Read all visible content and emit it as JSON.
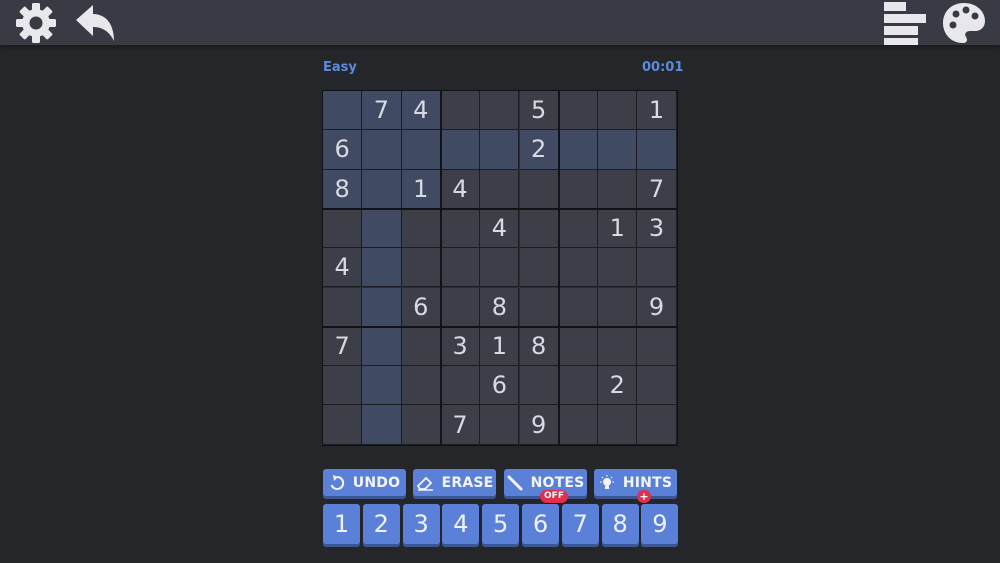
{
  "header": {
    "settings_icon": "gear-icon",
    "back_icon": "back-arrow-icon",
    "menu_icon": "bars-icon",
    "theme_icon": "palette-icon"
  },
  "status": {
    "difficulty": "Easy",
    "timer": "00:01"
  },
  "board": {
    "grid": [
      [
        "",
        "7",
        "4",
        "",
        "",
        "5",
        "",
        "",
        "1"
      ],
      [
        "6",
        "",
        "",
        "",
        "",
        "2",
        "",
        "",
        ""
      ],
      [
        "8",
        "",
        "1",
        "4",
        "",
        "",
        "",
        "",
        "7"
      ],
      [
        "",
        "",
        "",
        "",
        "4",
        "",
        "",
        "1",
        "3"
      ],
      [
        "4",
        "",
        "",
        "",
        "",
        "",
        "",
        "",
        ""
      ],
      [
        "",
        "",
        "6",
        "",
        "8",
        "",
        "",
        "",
        "9"
      ],
      [
        "7",
        "",
        "",
        "3",
        "1",
        "8",
        "",
        "",
        ""
      ],
      [
        "",
        "",
        "",
        "",
        "6",
        "",
        "",
        "2",
        ""
      ],
      [
        "",
        "",
        "",
        "7",
        "",
        "9",
        "",
        "",
        ""
      ]
    ],
    "selected_cell": {
      "row": 1,
      "col": 1
    }
  },
  "actions": {
    "undo": "UNDO",
    "erase": "ERASE",
    "notes": "NOTES",
    "notes_state": "OFF",
    "hints": "HINTS",
    "hints_badge": "+"
  },
  "numpad": [
    "1",
    "2",
    "3",
    "4",
    "5",
    "6",
    "7",
    "8",
    "9"
  ],
  "colors": {
    "accent": "#5a80d8",
    "highlight": "#404b63",
    "badge": "#e0304c",
    "status_text": "#5b8be0"
  }
}
